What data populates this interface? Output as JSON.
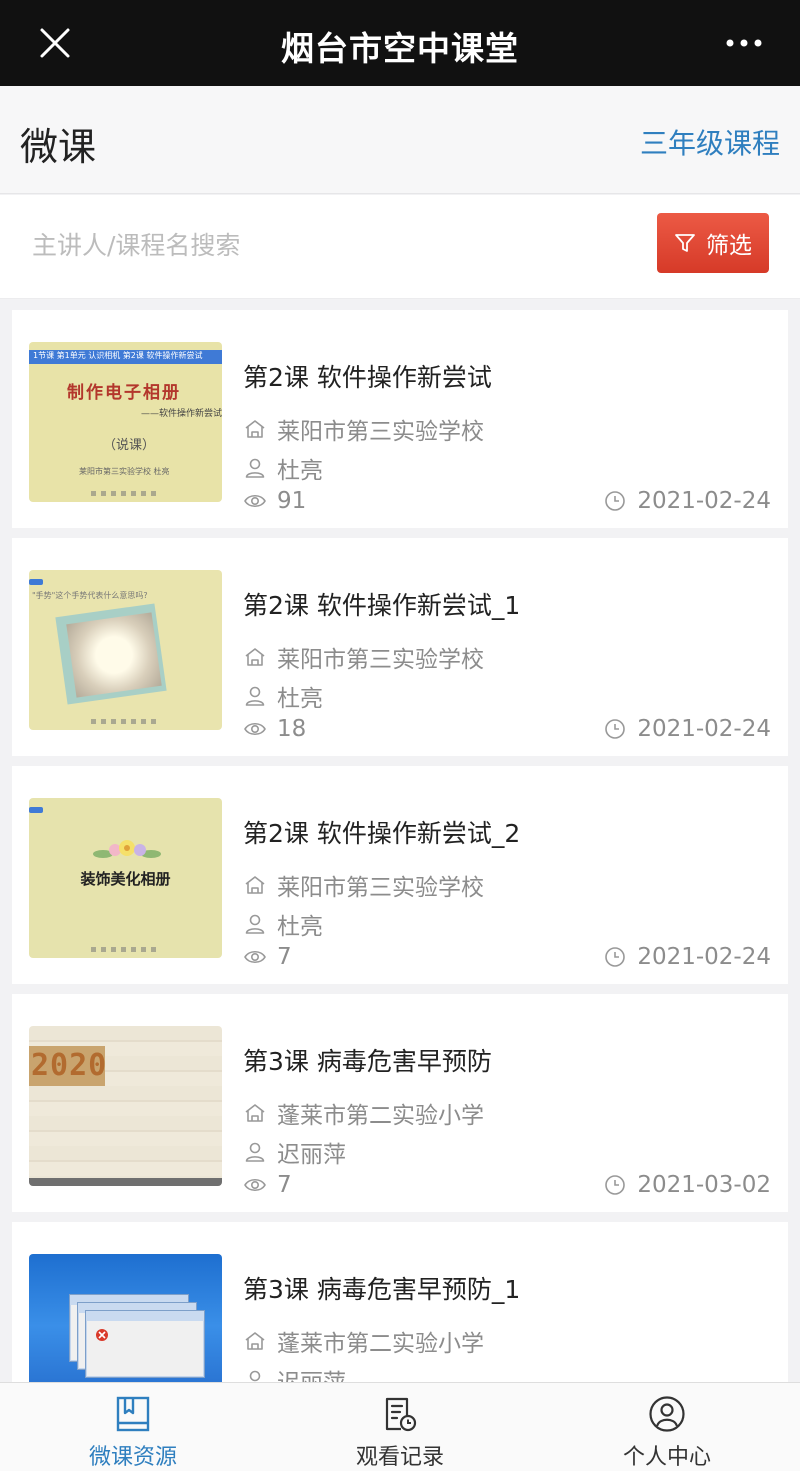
{
  "topbar": {
    "title": "烟台市空中课堂",
    "close_icon": "close-icon",
    "more_icon": "more-icon"
  },
  "header": {
    "title": "微课",
    "grade_link": "三年级课程"
  },
  "search": {
    "placeholder": "主讲人/课程名搜索",
    "value": "",
    "filter_label": "筛选"
  },
  "thumbs": {
    "t1_strip": "1节课 第1单元 认识相机 第2课 软件操作新尝试",
    "t1_big": "制作电子相册",
    "t1_sub": "——软件操作新尝试",
    "t1_paren": "（说课）",
    "t1_foot": "莱阳市第三实验学校  杜亮",
    "t2_question": "\"手势\"这个手势代表什么意思吗?",
    "t3_caption": "装饰美化相册",
    "t4_year": "2020"
  },
  "courses": [
    {
      "title": "第2课 软件操作新尝试",
      "school": "莱阳市第三实验学校",
      "teacher": "杜亮",
      "views": "91",
      "date": "2021-02-24"
    },
    {
      "title": "第2课 软件操作新尝试_1",
      "school": "莱阳市第三实验学校",
      "teacher": "杜亮",
      "views": "18",
      "date": "2021-02-24"
    },
    {
      "title": "第2课 软件操作新尝试_2",
      "school": "莱阳市第三实验学校",
      "teacher": "杜亮",
      "views": "7",
      "date": "2021-02-24"
    },
    {
      "title": "第3课 病毒危害早预防",
      "school": "蓬莱市第二实验小学",
      "teacher": "迟丽萍",
      "views": "7",
      "date": "2021-03-02"
    },
    {
      "title": "第3课 病毒危害早预防_1",
      "school": "蓬莱市第二实验小学",
      "teacher": "迟丽萍",
      "views": "",
      "date": ""
    }
  ],
  "tabbar": {
    "items": [
      {
        "label": "微课资源",
        "icon": "book-icon",
        "active": true
      },
      {
        "label": "观看记录",
        "icon": "history-icon",
        "active": false
      },
      {
        "label": "个人中心",
        "icon": "user-circle-icon",
        "active": false
      }
    ]
  },
  "colors": {
    "accent": "#2f7fbf",
    "filter": "#e04a36",
    "topbar": "#111111"
  }
}
